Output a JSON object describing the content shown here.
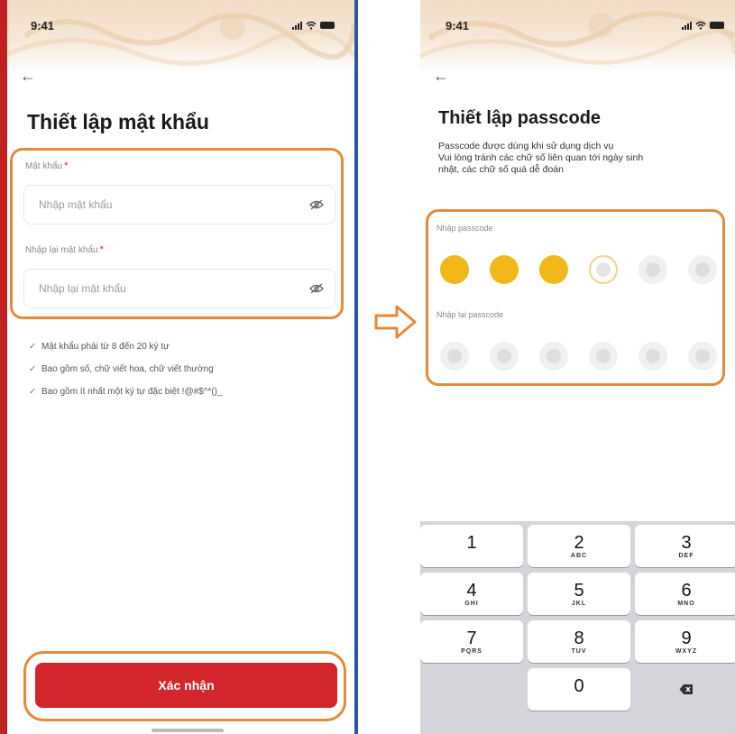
{
  "left_screen": {
    "status_time": "9:41",
    "title": "Thiết lập mật khẩu",
    "password_label": "Mật khẩu",
    "password_placeholder": "Nhập mật khẩu",
    "confirm_label": "Nhập lại mật khẩu",
    "confirm_placeholder": "Nhập lại mật khẩu",
    "required_mark": "*",
    "rules": [
      "Mật khẩu phải từ 8 đến 20 ký tự",
      "Bao gồm số, chữ viết hoa, chữ viết thường",
      "Bao gồm ít nhất một ký tự đặc biệt !@#$^*()_"
    ],
    "confirm_button": "Xác nhận"
  },
  "right_screen": {
    "status_time": "9:41",
    "title": "Thiết lập passcode",
    "description": [
      "Passcode được dùng khi sử dụng dịch vụ",
      "Vui lòng tránh các chữ số liên quan tới ngày sinh",
      "nhật, các chữ số quá dễ đoán"
    ],
    "passcode_label": "Nhập passcode",
    "repeat_label": "Nhập lại passcode",
    "passcode_entered": 3,
    "passcode_length": 6,
    "keypad": [
      {
        "digit": "1",
        "letters": ""
      },
      {
        "digit": "2",
        "letters": "ABC"
      },
      {
        "digit": "3",
        "letters": "DEF"
      },
      {
        "digit": "4",
        "letters": "GHI"
      },
      {
        "digit": "5",
        "letters": "JKL"
      },
      {
        "digit": "6",
        "letters": "MNO"
      },
      {
        "digit": "7",
        "letters": "PQRS"
      },
      {
        "digit": "8",
        "letters": "TUV"
      },
      {
        "digit": "9",
        "letters": "WXYZ"
      },
      {
        "digit": "0",
        "letters": ""
      }
    ]
  },
  "icons": {
    "back": "arrow-left-icon",
    "eye": "eye-off-icon",
    "check": "check-icon",
    "backspace": "backspace-icon",
    "transition": "arrow-right-icon"
  },
  "colors": {
    "brand_red": "#d2262c",
    "highlight_orange": "#e58a38",
    "passcode_filled": "#f2b81a",
    "page_background": "#c0201f"
  }
}
